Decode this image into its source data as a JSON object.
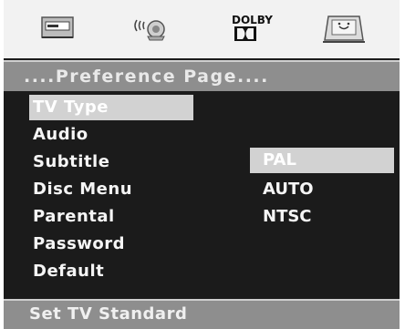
{
  "toolbar": {
    "icons": [
      {
        "name": "general-setup-icon"
      },
      {
        "name": "audio-setup-icon"
      },
      {
        "name": "dolby-setup-icon",
        "label": "DOLBY"
      },
      {
        "name": "preference-setup-icon"
      }
    ]
  },
  "page_title": "....Preference Page....",
  "menu_items": [
    "TV Type",
    "Audio",
    "Subtitle",
    "Disc Menu",
    "Parental",
    "Password",
    "Default"
  ],
  "selected_menu_index": 0,
  "options": [
    "PAL",
    "AUTO",
    "NTSC"
  ],
  "selected_option_index": 0,
  "status_text": "Set TV Standard",
  "colors": {
    "highlight": "#d2d2d2",
    "background": "#1b1b1b",
    "bar": "#8e8e8e",
    "toolbar": "#f2f2f2"
  }
}
